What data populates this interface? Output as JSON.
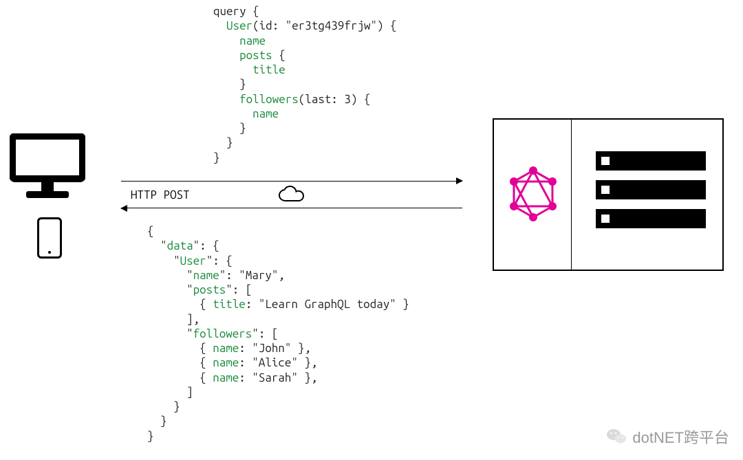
{
  "label": {
    "http_post": "HTTP POST"
  },
  "query": {
    "l1": "query {",
    "l2_a": "  ",
    "l2_b": "User",
    "l2_c": "(id: \"er3tg439frjw\") {",
    "l3_a": "    ",
    "l3_b": "name",
    "l4_a": "    ",
    "l4_b": "posts",
    "l4_c": " {",
    "l5_a": "      ",
    "l5_b": "title",
    "l6": "    }",
    "l7_a": "    ",
    "l7_b": "followers",
    "l7_c": "(last: 3) {",
    "l8_a": "      ",
    "l8_b": "name",
    "l9": "    }",
    "l10": "  }",
    "l11": "}"
  },
  "response": {
    "l1": "{",
    "l2_a": "  \"",
    "l2_b": "data",
    "l2_c": "\": {",
    "l3_a": "    \"",
    "l3_b": "User",
    "l3_c": "\": {",
    "l4_a": "      \"",
    "l4_b": "name",
    "l4_c": "\": \"Mary\",",
    "l5_a": "      \"",
    "l5_b": "posts",
    "l5_c": "\": [",
    "l6_a": "        { ",
    "l6_b": "title",
    "l6_c": ": \"Learn GraphQL today\" }",
    "l7": "      ],",
    "l8_a": "      \"",
    "l8_b": "followers",
    "l8_c": "\": [",
    "l9_a": "        { ",
    "l9_b": "name",
    "l9_c": ": \"John\" },",
    "l10_a": "        { ",
    "l10_b": "name",
    "l10_c": ": \"Alice\" },",
    "l11_a": "        { ",
    "l11_b": "name",
    "l11_c": ": \"Sarah\" },",
    "l12": "      ]",
    "l13": "    }",
    "l14": "  }",
    "l15": "}"
  },
  "watermark": {
    "text": "dotNET跨平台"
  },
  "diagram": {
    "clients": [
      "desktop-monitor",
      "mobile-phone"
    ],
    "transport": {
      "method": "HTTP POST",
      "direction": "request→response",
      "medium": "cloud/network"
    },
    "server": {
      "gateway": "GraphQL",
      "backends": [
        "db-1",
        "db-2",
        "db-3"
      ]
    },
    "request_summary": "query User(id) { name; posts{title}; followers(last:3){name} }",
    "response_summary": {
      "User": {
        "name": "Mary",
        "posts": [
          {
            "title": "Learn GraphQL today"
          }
        ],
        "followers": [
          {
            "name": "John"
          },
          {
            "name": "Alice"
          },
          {
            "name": "Sarah"
          }
        ]
      }
    }
  }
}
